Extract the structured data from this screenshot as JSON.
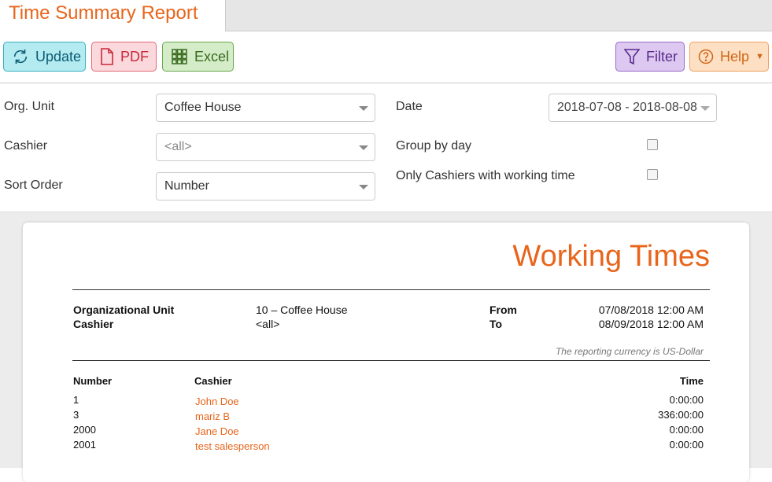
{
  "tab": {
    "title": "Time Summary Report"
  },
  "toolbar": {
    "update_label": "Update",
    "pdf_label": "PDF",
    "excel_label": "Excel",
    "filter_label": "Filter",
    "help_label": "Help"
  },
  "form": {
    "org_unit": {
      "label": "Org. Unit",
      "value": "Coffee House"
    },
    "cashier": {
      "label": "Cashier",
      "value": "<all>"
    },
    "sort_order": {
      "label": "Sort Order",
      "value": "Number"
    },
    "date": {
      "label": "Date",
      "value": "2018-07-08 - 2018-08-08"
    },
    "group_by_day": {
      "label": "Group by day",
      "checked": false
    },
    "only_cashiers": {
      "label": "Only Cashiers with working time",
      "checked": false
    }
  },
  "report": {
    "title": "Working Times",
    "meta": {
      "org_unit_label": "Organizational Unit",
      "org_unit_value": "10 – Coffee House",
      "cashier_label": "Cashier",
      "cashier_value": "<all>",
      "from_label": "From",
      "from_value": "07/08/2018 12:00 AM",
      "to_label": "To",
      "to_value": "08/09/2018 12:00 AM"
    },
    "currency_note": "The reporting currency is US-Dollar",
    "columns": {
      "number": "Number",
      "cashier": "Cashier",
      "time": "Time"
    },
    "rows": [
      {
        "number": "1",
        "cashier": "John Doe",
        "time": "0:00:00"
      },
      {
        "number": "3",
        "cashier": "mariz B",
        "time": "336:00:00"
      },
      {
        "number": "2000",
        "cashier": "Jane Doe",
        "time": "0:00:00"
      },
      {
        "number": "2001",
        "cashier": "test salesperson",
        "time": "0:00:00"
      }
    ]
  },
  "colors": {
    "accent": "#e8651c"
  }
}
